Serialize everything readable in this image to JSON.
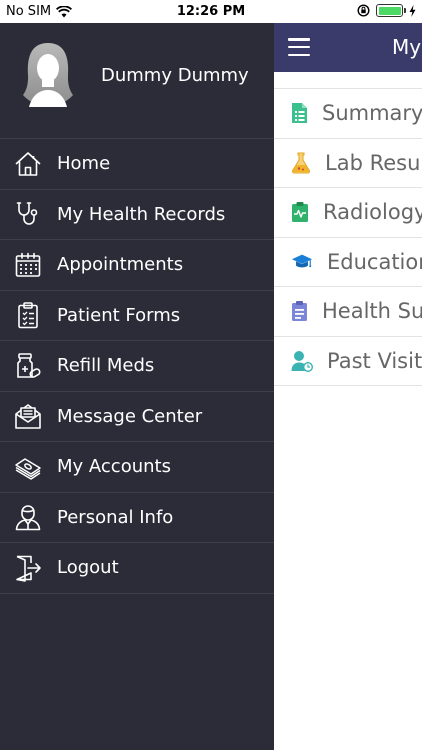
{
  "status_bar": {
    "carrier": "No SIM",
    "time": "12:26 PM"
  },
  "drawer": {
    "user_name": "Dummy Dummy",
    "items": [
      {
        "label": "Home",
        "icon": "home-icon"
      },
      {
        "label": "My Health Records",
        "icon": "stethoscope-icon"
      },
      {
        "label": "Appointments",
        "icon": "calendar-icon"
      },
      {
        "label": "Patient Forms",
        "icon": "clipboard-icon"
      },
      {
        "label": "Refill Meds",
        "icon": "pill-bottle-icon"
      },
      {
        "label": "Message Center",
        "icon": "envelope-icon"
      },
      {
        "label": "My Accounts",
        "icon": "money-icon"
      },
      {
        "label": "Personal Info",
        "icon": "person-icon"
      },
      {
        "label": "Logout",
        "icon": "logout-icon"
      }
    ]
  },
  "main": {
    "title": "My",
    "items": [
      {
        "label": "Summary",
        "icon": "summary-icon",
        "color": "#3cc08e"
      },
      {
        "label": "Lab Resul",
        "icon": "flask-icon",
        "color": "#f0b429"
      },
      {
        "label": "Radiology",
        "icon": "radiology-icon",
        "color": "#2fb36b"
      },
      {
        "label": "Educatior",
        "icon": "graduation-cap-icon",
        "color": "#1a7fd6"
      },
      {
        "label": "Health Su",
        "icon": "survey-icon",
        "color": "#7b86d9"
      },
      {
        "label": "Past Visits",
        "icon": "user-clock-icon",
        "color": "#3bb3b3"
      }
    ]
  },
  "colors": {
    "drawer_bg": "#2b2c38",
    "topbar_bg": "#3a3b6a",
    "battery": "#4cd964"
  }
}
